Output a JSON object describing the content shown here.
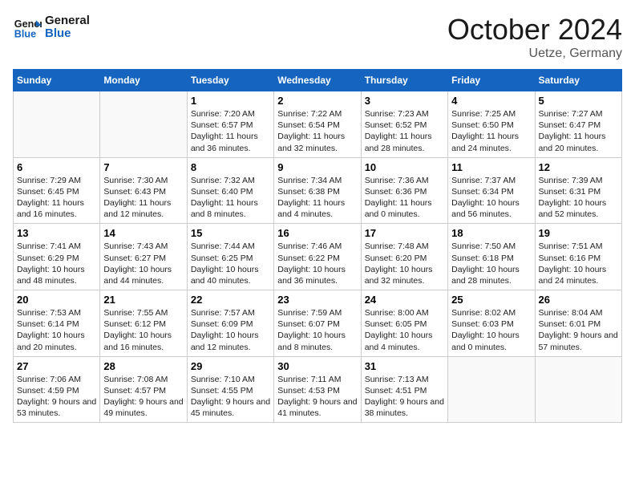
{
  "logo": {
    "line1": "General",
    "line2": "Blue"
  },
  "title": "October 2024",
  "location": "Uetze, Germany",
  "weekdays": [
    "Sunday",
    "Monday",
    "Tuesday",
    "Wednesday",
    "Thursday",
    "Friday",
    "Saturday"
  ],
  "weeks": [
    [
      {
        "day": "",
        "info": ""
      },
      {
        "day": "",
        "info": ""
      },
      {
        "day": "1",
        "info": "Sunrise: 7:20 AM\nSunset: 6:57 PM\nDaylight: 11 hours and 36 minutes."
      },
      {
        "day": "2",
        "info": "Sunrise: 7:22 AM\nSunset: 6:54 PM\nDaylight: 11 hours and 32 minutes."
      },
      {
        "day": "3",
        "info": "Sunrise: 7:23 AM\nSunset: 6:52 PM\nDaylight: 11 hours and 28 minutes."
      },
      {
        "day": "4",
        "info": "Sunrise: 7:25 AM\nSunset: 6:50 PM\nDaylight: 11 hours and 24 minutes."
      },
      {
        "day": "5",
        "info": "Sunrise: 7:27 AM\nSunset: 6:47 PM\nDaylight: 11 hours and 20 minutes."
      }
    ],
    [
      {
        "day": "6",
        "info": "Sunrise: 7:29 AM\nSunset: 6:45 PM\nDaylight: 11 hours and 16 minutes."
      },
      {
        "day": "7",
        "info": "Sunrise: 7:30 AM\nSunset: 6:43 PM\nDaylight: 11 hours and 12 minutes."
      },
      {
        "day": "8",
        "info": "Sunrise: 7:32 AM\nSunset: 6:40 PM\nDaylight: 11 hours and 8 minutes."
      },
      {
        "day": "9",
        "info": "Sunrise: 7:34 AM\nSunset: 6:38 PM\nDaylight: 11 hours and 4 minutes."
      },
      {
        "day": "10",
        "info": "Sunrise: 7:36 AM\nSunset: 6:36 PM\nDaylight: 11 hours and 0 minutes."
      },
      {
        "day": "11",
        "info": "Sunrise: 7:37 AM\nSunset: 6:34 PM\nDaylight: 10 hours and 56 minutes."
      },
      {
        "day": "12",
        "info": "Sunrise: 7:39 AM\nSunset: 6:31 PM\nDaylight: 10 hours and 52 minutes."
      }
    ],
    [
      {
        "day": "13",
        "info": "Sunrise: 7:41 AM\nSunset: 6:29 PM\nDaylight: 10 hours and 48 minutes."
      },
      {
        "day": "14",
        "info": "Sunrise: 7:43 AM\nSunset: 6:27 PM\nDaylight: 10 hours and 44 minutes."
      },
      {
        "day": "15",
        "info": "Sunrise: 7:44 AM\nSunset: 6:25 PM\nDaylight: 10 hours and 40 minutes."
      },
      {
        "day": "16",
        "info": "Sunrise: 7:46 AM\nSunset: 6:22 PM\nDaylight: 10 hours and 36 minutes."
      },
      {
        "day": "17",
        "info": "Sunrise: 7:48 AM\nSunset: 6:20 PM\nDaylight: 10 hours and 32 minutes."
      },
      {
        "day": "18",
        "info": "Sunrise: 7:50 AM\nSunset: 6:18 PM\nDaylight: 10 hours and 28 minutes."
      },
      {
        "day": "19",
        "info": "Sunrise: 7:51 AM\nSunset: 6:16 PM\nDaylight: 10 hours and 24 minutes."
      }
    ],
    [
      {
        "day": "20",
        "info": "Sunrise: 7:53 AM\nSunset: 6:14 PM\nDaylight: 10 hours and 20 minutes."
      },
      {
        "day": "21",
        "info": "Sunrise: 7:55 AM\nSunset: 6:12 PM\nDaylight: 10 hours and 16 minutes."
      },
      {
        "day": "22",
        "info": "Sunrise: 7:57 AM\nSunset: 6:09 PM\nDaylight: 10 hours and 12 minutes."
      },
      {
        "day": "23",
        "info": "Sunrise: 7:59 AM\nSunset: 6:07 PM\nDaylight: 10 hours and 8 minutes."
      },
      {
        "day": "24",
        "info": "Sunrise: 8:00 AM\nSunset: 6:05 PM\nDaylight: 10 hours and 4 minutes."
      },
      {
        "day": "25",
        "info": "Sunrise: 8:02 AM\nSunset: 6:03 PM\nDaylight: 10 hours and 0 minutes."
      },
      {
        "day": "26",
        "info": "Sunrise: 8:04 AM\nSunset: 6:01 PM\nDaylight: 9 hours and 57 minutes."
      }
    ],
    [
      {
        "day": "27",
        "info": "Sunrise: 7:06 AM\nSunset: 4:59 PM\nDaylight: 9 hours and 53 minutes."
      },
      {
        "day": "28",
        "info": "Sunrise: 7:08 AM\nSunset: 4:57 PM\nDaylight: 9 hours and 49 minutes."
      },
      {
        "day": "29",
        "info": "Sunrise: 7:10 AM\nSunset: 4:55 PM\nDaylight: 9 hours and 45 minutes."
      },
      {
        "day": "30",
        "info": "Sunrise: 7:11 AM\nSunset: 4:53 PM\nDaylight: 9 hours and 41 minutes."
      },
      {
        "day": "31",
        "info": "Sunrise: 7:13 AM\nSunset: 4:51 PM\nDaylight: 9 hours and 38 minutes."
      },
      {
        "day": "",
        "info": ""
      },
      {
        "day": "",
        "info": ""
      }
    ]
  ]
}
